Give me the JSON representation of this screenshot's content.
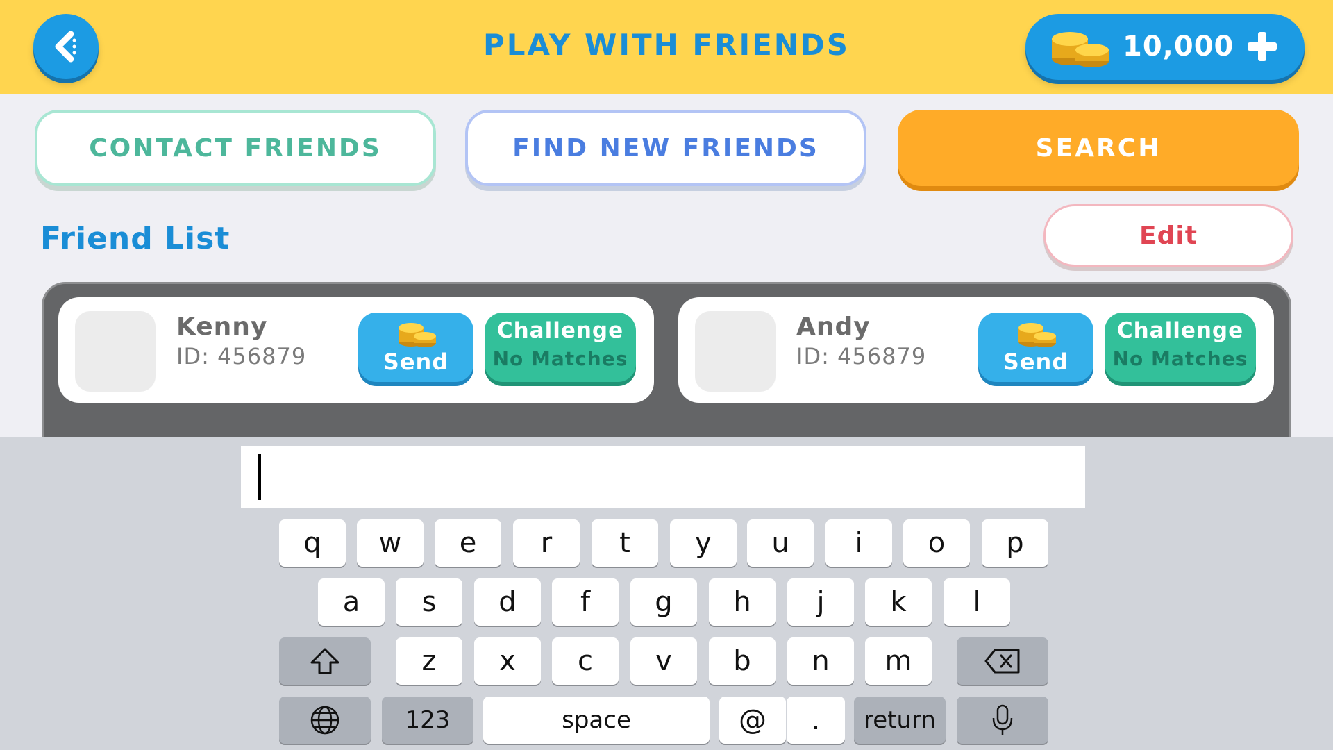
{
  "header": {
    "title": "PLAY WITH FRIENDS",
    "coins": "10,000"
  },
  "tabs": {
    "contact": "CONTACT FRIENDS",
    "find": "FIND NEW FRIENDS",
    "search": "SEARCH"
  },
  "friend_list": {
    "title": "Friend List",
    "edit_label": "Edit",
    "friends": [
      {
        "name": "Kenny",
        "id": "ID: 456879",
        "send_label": "Send",
        "challenge_label": "Challenge",
        "challenge_sub": "No Matches"
      },
      {
        "name": "Andy",
        "id": "ID: 456879",
        "send_label": "Send",
        "challenge_label": "Challenge",
        "challenge_sub": "No Matches"
      }
    ]
  },
  "search_input": {
    "value": ""
  },
  "keyboard": {
    "row1": [
      "q",
      "w",
      "e",
      "r",
      "t",
      "y",
      "u",
      "i",
      "o",
      "p"
    ],
    "row2": [
      "a",
      "s",
      "d",
      "f",
      "g",
      "h",
      "j",
      "k",
      "l"
    ],
    "row3": [
      "z",
      "x",
      "c",
      "v",
      "b",
      "n",
      "m"
    ],
    "numbers_label": "123",
    "space_label": "space",
    "at_label": "@",
    "dot_label": ".",
    "return_label": "return"
  },
  "colors": {
    "header_bg": "#ffd54f",
    "accent_blue": "#1a8dd6",
    "search_orange": "#ffab28",
    "challenge_green": "#33c09a",
    "edit_red": "#e04553"
  }
}
